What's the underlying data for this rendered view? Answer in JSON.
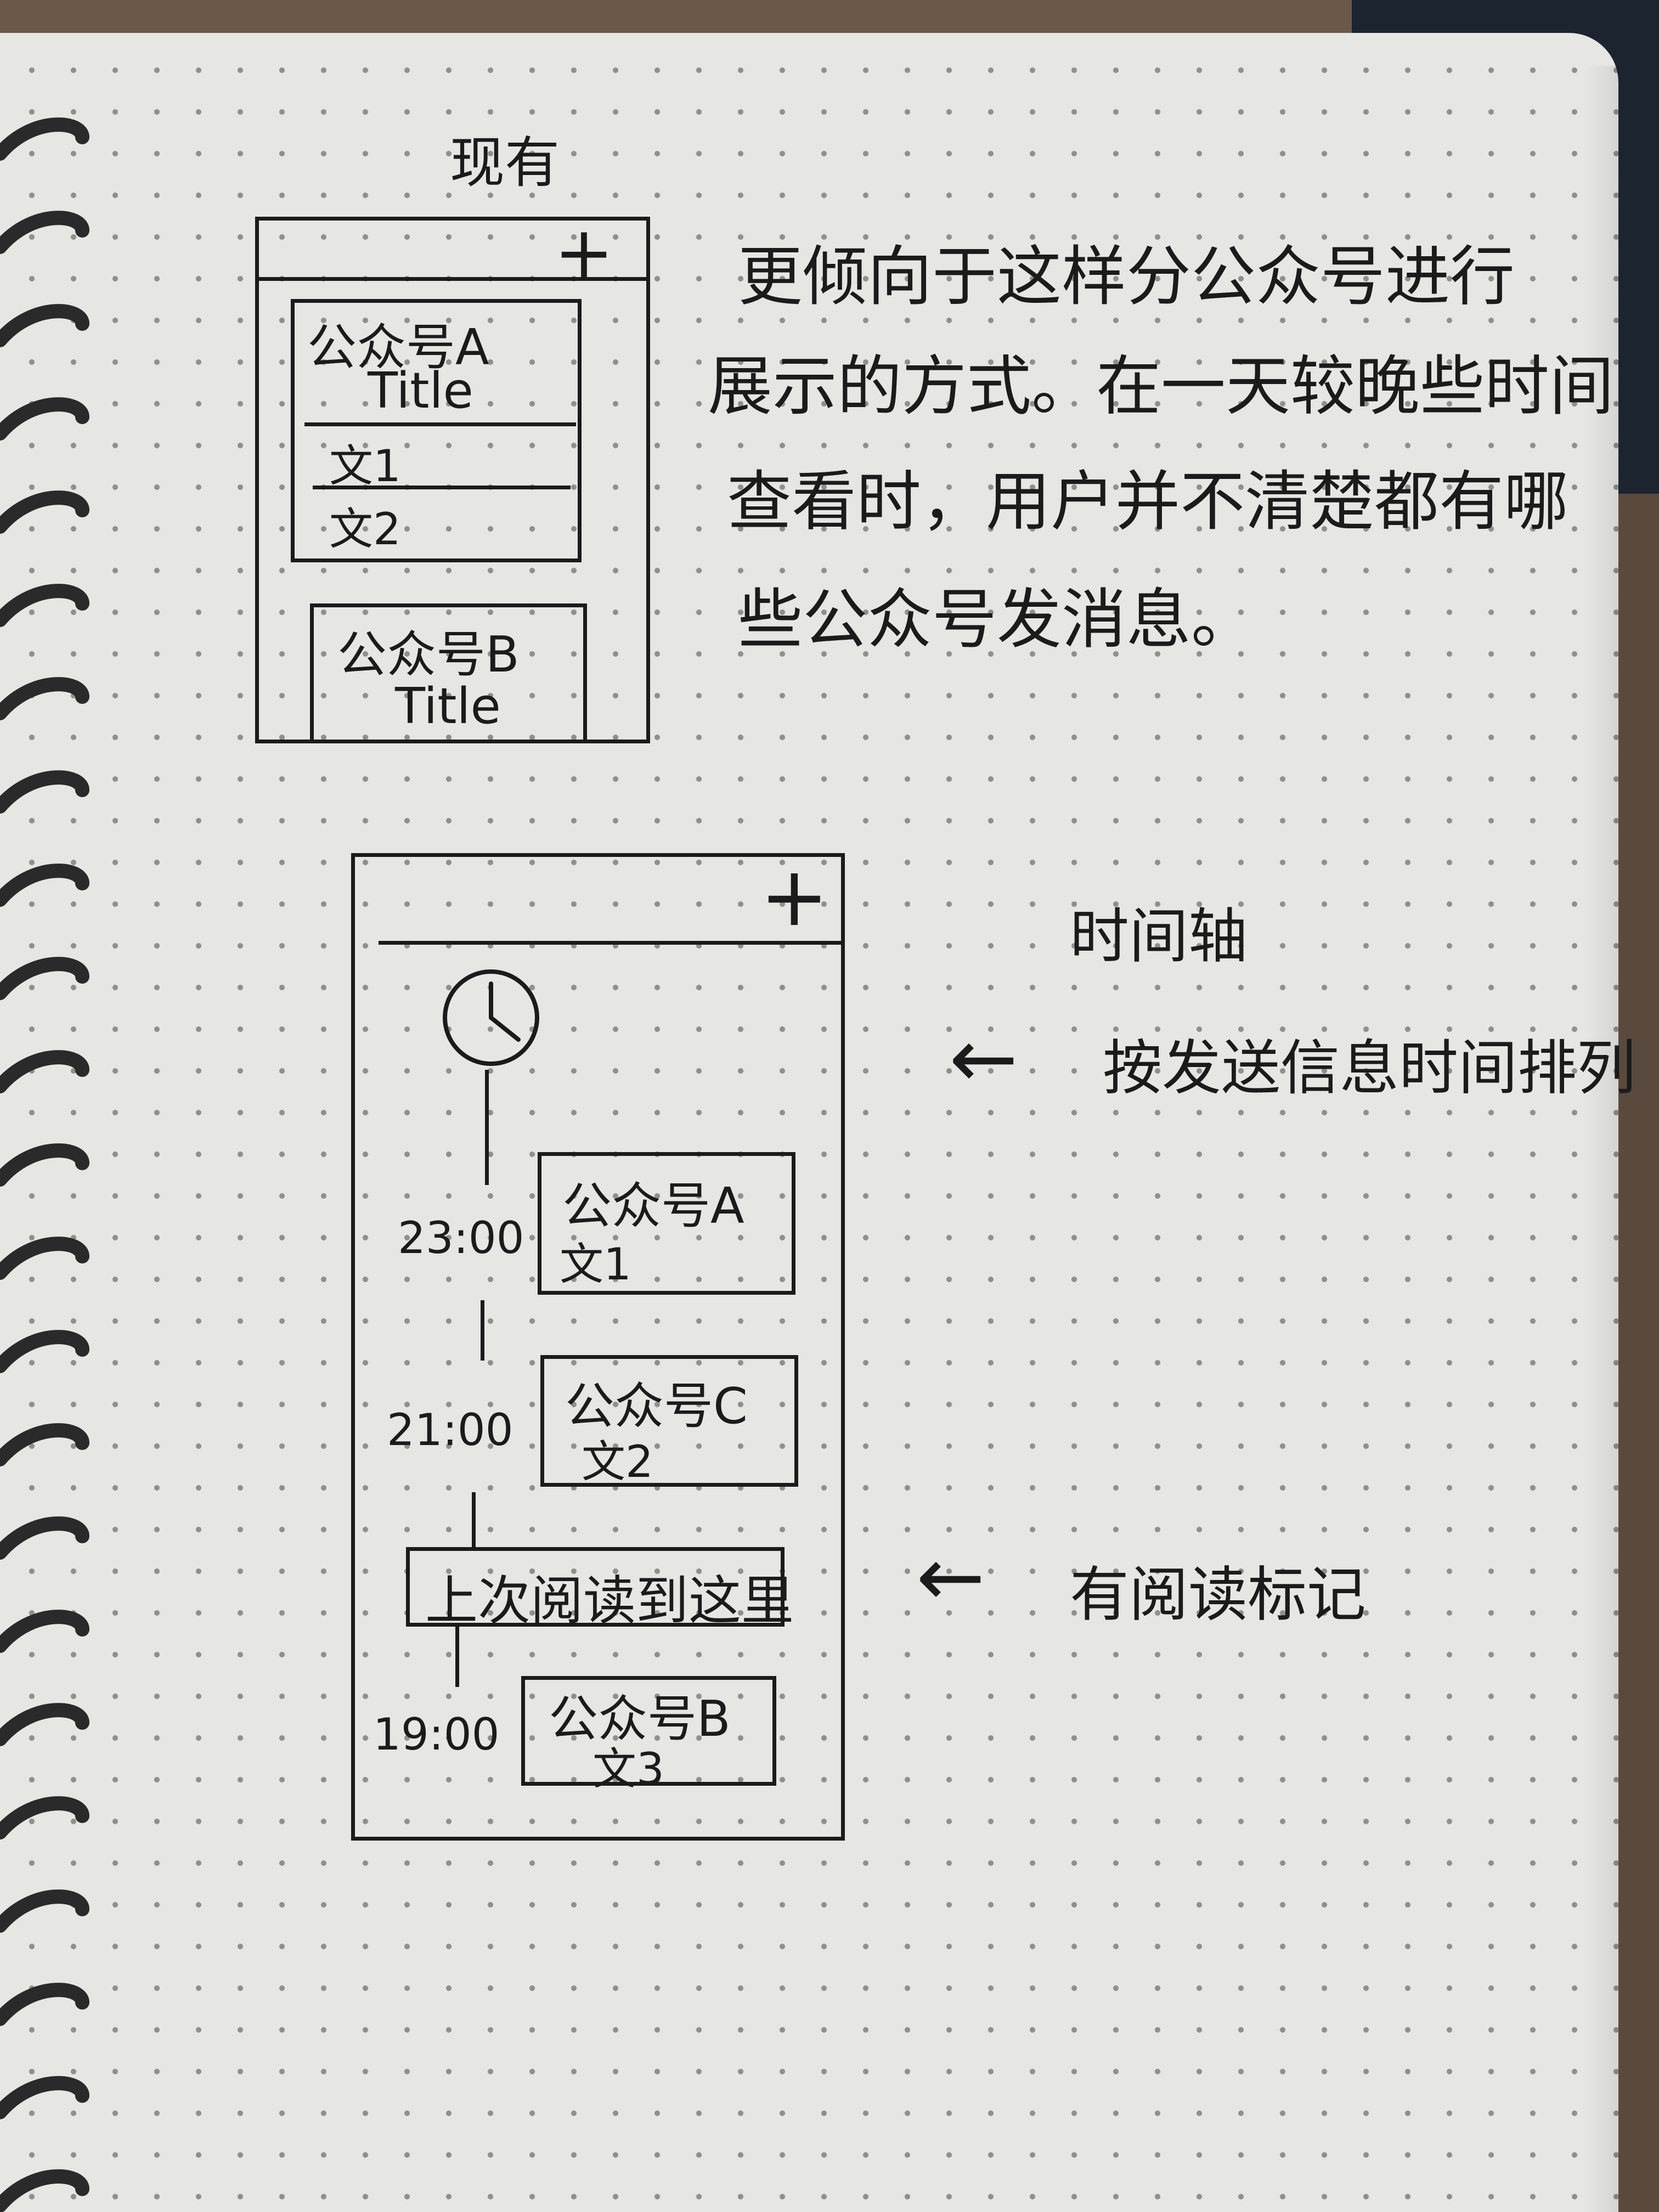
{
  "top_sketch": {
    "heading": "现有",
    "plus": "+",
    "card_a": {
      "account": "公众号A",
      "title": "Title",
      "items": [
        "文1",
        "文2"
      ]
    },
    "card_b": {
      "account": "公众号B",
      "title": "Title"
    }
  },
  "description": {
    "lines": [
      "更倾向于这样分公众号进行",
      "展示的方式。在一天较晚些时间",
      "查看时，用户并不清楚都有哪",
      "些公众号发消息。"
    ]
  },
  "bottom_sketch": {
    "plus": "+",
    "timeline": [
      {
        "time": "23:00",
        "account": "公众号A",
        "article": "文1"
      },
      {
        "time": "21:00",
        "account": "公众号C",
        "article": "文2"
      },
      {
        "time": "19:00",
        "account": "公众号B",
        "article": "文3"
      }
    ],
    "last_read_marker": "上次阅读到这里"
  },
  "annotations": {
    "timeline_label": "时间轴",
    "sort_note": "按发送信息时间排列",
    "read_record_note": "有阅读标记",
    "arrow_1": "←",
    "arrow_2": "←"
  }
}
